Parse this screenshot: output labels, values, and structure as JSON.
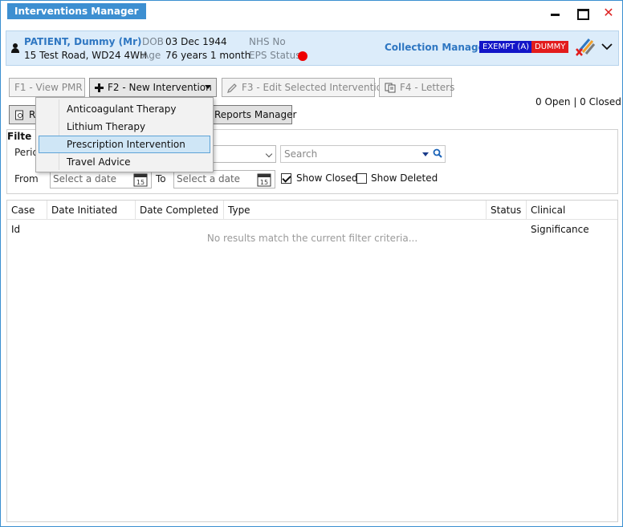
{
  "window": {
    "title": "Interventions Manager",
    "close_symbol": "✕"
  },
  "patient": {
    "name": "PATIENT, Dummy (Mr)",
    "address": "15 Test Road, WD24 4WH",
    "dob_label": "DOB",
    "dob": "03 Dec 1944",
    "age_label": "Age",
    "age": "76 years 1 month",
    "nhs_label": "NHS No",
    "eps_label": "EPS Status",
    "collection_manager": "Collection Manager",
    "badges": [
      "EXEMPT (A)",
      "DUMMY"
    ]
  },
  "toolbar": {
    "f1": "F1 - View PMR",
    "f2": "F2 - New Intervention",
    "f3": "F3 - Edit Selected Intervention",
    "f4": "F4 - Letters",
    "reports_prefix": "R",
    "reports": "Reports Manager"
  },
  "counts": "0 Open | 0 Closed",
  "filter": {
    "title": "Filter",
    "title_visible": "Filte",
    "period_label_visible": "Perio",
    "search_placeholder": "Search",
    "from_label": "From",
    "to_label": "To",
    "date_placeholder": "Select a date",
    "calendar_day": "15",
    "show_closed": "Show Closed",
    "show_deleted": "Show Deleted"
  },
  "table": {
    "columns": [
      "Case Id",
      "Date Initiated",
      "Date Completed",
      "Type",
      "Status",
      "Clinical Significance"
    ],
    "empty_message": "No results match the current filter criteria..."
  },
  "menu": {
    "items": [
      "Anticoagulant Therapy",
      "Lithium Therapy",
      "Prescription Intervention",
      "Travel Advice"
    ],
    "highlighted": "Prescription Intervention"
  },
  "colors": {
    "accent": "#3d8fd1",
    "patient_name": "#2f77c2",
    "banner_bg": "#dcecfa",
    "exempt_badge": "#1215c8",
    "dummy_badge": "#e21c1c",
    "eps_status": "#ee0000"
  }
}
